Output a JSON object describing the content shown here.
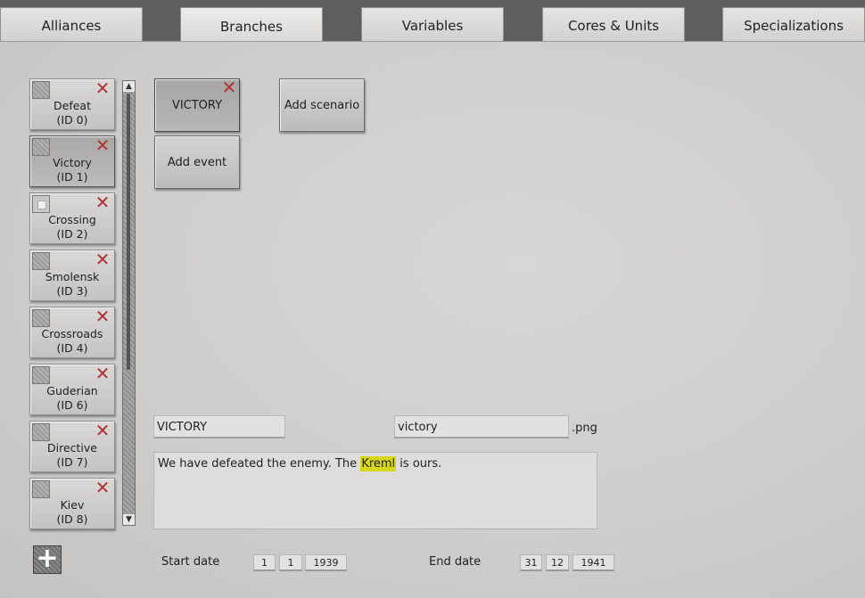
{
  "tabs": [
    {
      "label": "Alliances"
    },
    {
      "label": "Branches"
    },
    {
      "label": "Variables"
    },
    {
      "label": "Cores & Units"
    },
    {
      "label": "Specializations"
    }
  ],
  "active_tab": "Branches",
  "branches": [
    {
      "name": "Defeat",
      "id": "(ID 0)"
    },
    {
      "name": "Victory",
      "id": "(ID 1)"
    },
    {
      "name": "Crossing",
      "id": "(ID 2)"
    },
    {
      "name": "Smolensk",
      "id": "(ID 3)"
    },
    {
      "name": "Crossroads",
      "id": "(ID 4)"
    },
    {
      "name": "Guderian",
      "id": "(ID 6)"
    },
    {
      "name": "Directive",
      "id": "(ID 7)"
    },
    {
      "name": "Kiev",
      "id": "(ID 8)"
    }
  ],
  "selected_branch": "Victory",
  "scenario": {
    "button_label": "VICTORY",
    "add_scenario_label": "Add scenario",
    "add_event_label": "Add event"
  },
  "editor": {
    "name_value": "VICTORY",
    "image_value": "victory",
    "image_suffix": ".png",
    "description_before": "We have defeated the enemy. The ",
    "description_highlight": "Kreml",
    "description_after": " is ours."
  },
  "dates": {
    "start_label": "Start date",
    "start_day": "1",
    "start_month": "1",
    "start_year": "1939",
    "end_label": "End date",
    "end_day": "31",
    "end_month": "12",
    "end_year": "1941"
  },
  "colors": {
    "highlight": "#d6d61a",
    "delete_x": "#b03434"
  }
}
